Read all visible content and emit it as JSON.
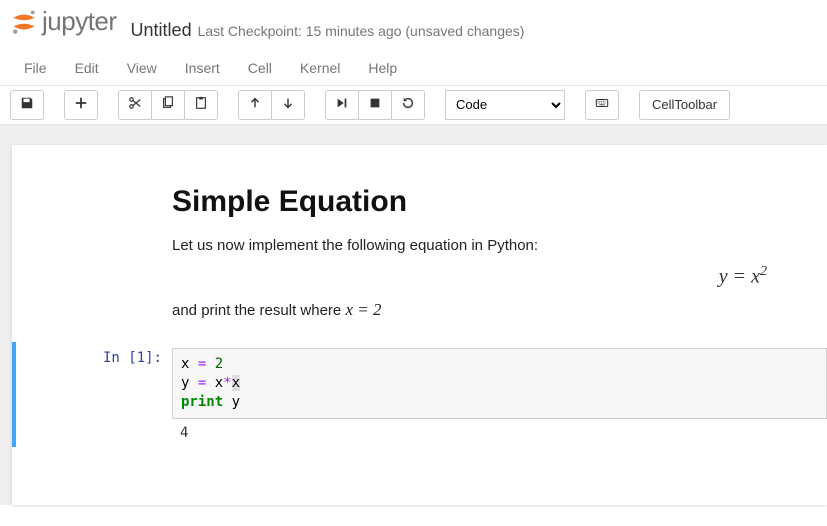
{
  "header": {
    "logo_text": "jupyter",
    "title": "Untitled",
    "checkpoint": "Last Checkpoint: 15 minutes ago (unsaved changes)"
  },
  "menu": {
    "items": [
      "File",
      "Edit",
      "View",
      "Insert",
      "Cell",
      "Kernel",
      "Help"
    ]
  },
  "toolbar": {
    "celltype_value": "Code",
    "celltoolbar_label": "CellToolbar"
  },
  "notebook": {
    "markdown": {
      "heading": "Simple Equation",
      "line1": "Let us now implement the following equation in Python:",
      "equation_display": "y = x",
      "equation_display_sup": "2",
      "line2a": "and print the result where ",
      "line2b_math": "x = 2"
    },
    "code_cell": {
      "prompt": "In [1]:",
      "lines": {
        "l1": {
          "a": "x",
          "eq": "=",
          "n": "2"
        },
        "l2": {
          "a": "y",
          "eq": "=",
          "b": "x",
          "star": "*",
          "c": "x"
        },
        "l3": {
          "kw": "print",
          "arg": "y"
        }
      },
      "output": "4"
    }
  }
}
